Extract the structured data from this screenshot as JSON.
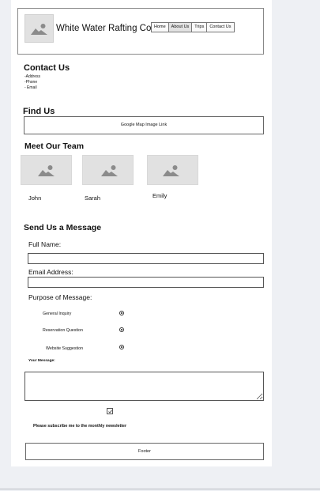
{
  "header": {
    "title": "White Water Rafting Co.",
    "logo_icon": "image-placeholder-icon",
    "nav": [
      {
        "label": "Home",
        "active": false
      },
      {
        "label": "About Us",
        "active": true
      },
      {
        "label": "Trips",
        "active": false
      },
      {
        "label": "Contact Us",
        "active": false
      }
    ]
  },
  "contact": {
    "title": "Contact Us",
    "items": [
      "-Address",
      "-Phone",
      "- Email"
    ]
  },
  "find_us": {
    "title": "Find Us",
    "map_text": "Google Map Image Link"
  },
  "team": {
    "title": "Meet Our Team",
    "members": [
      {
        "name": "John",
        "photo_icon": "image-placeholder-icon"
      },
      {
        "name": "Sarah",
        "photo_icon": "image-placeholder-icon"
      },
      {
        "name": "Emily",
        "photo_icon": "image-placeholder-icon"
      }
    ]
  },
  "message_form": {
    "title": "Send Us a Message",
    "full_name_label": "Full Name:",
    "full_name_value": "",
    "email_label": "Email Address:",
    "email_value": "",
    "purpose_label": "Purpose of Message:",
    "purpose_options": [
      {
        "label": "General Inquiry",
        "selected": true
      },
      {
        "label": "Reservation Question",
        "selected": true
      },
      {
        "label": "Website Suggestion",
        "selected": true
      }
    ],
    "message_label": "Your Message:",
    "message_value": "",
    "newsletter_checked": true,
    "newsletter_label": "Please subscribe me to the monthly newsletter"
  },
  "footer": {
    "text": "Footer"
  },
  "colors": {
    "page_background": "#eef0f4",
    "content_background": "#ffffff",
    "border": "#666666",
    "placeholder": "#e1e1e1",
    "placeholder_icon": "#8b8b8b"
  }
}
